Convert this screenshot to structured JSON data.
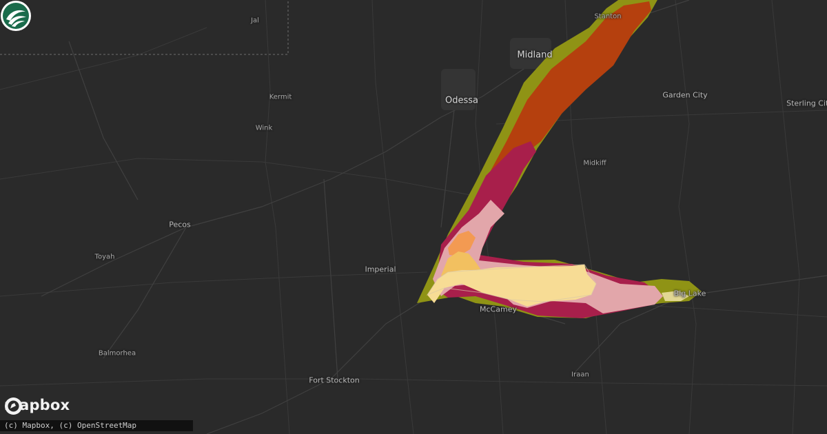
{
  "map": {
    "labels": {
      "jal": "Jal",
      "kermit": "Kermit",
      "wink": "Wink",
      "odessa": "Odessa",
      "midland": "Midland",
      "stanton": "Stanton",
      "garden_city": "Garden City",
      "sterling_city": "Sterling City",
      "midkiff": "Midkiff",
      "pecos": "Pecos",
      "toyah": "Toyah",
      "imperial": "Imperial",
      "mccamey": "McCamey",
      "big_lake": "Big Lake",
      "balmorhea": "Balmorhea",
      "fort_stockton": "Fort Stockton",
      "iraan": "Iraan"
    },
    "colors": {
      "background": "#2a2a2a",
      "swath_outer": "#8f9315",
      "swath_orange": "#b5400e",
      "swath_crimson": "#a81f4b",
      "swath_pink": "#e2a6aa",
      "swath_light_orange": "#f39a52",
      "swath_yellow": "#f2c060",
      "swath_cream": "#f7dc95"
    }
  },
  "attribution": {
    "text": "(c) Mapbox, (c) OpenStreetMap"
  },
  "brand": {
    "name": "mapbox",
    "logo_icon": "mapbox-logo-icon",
    "corner_icon": "swirl-logo-icon"
  }
}
